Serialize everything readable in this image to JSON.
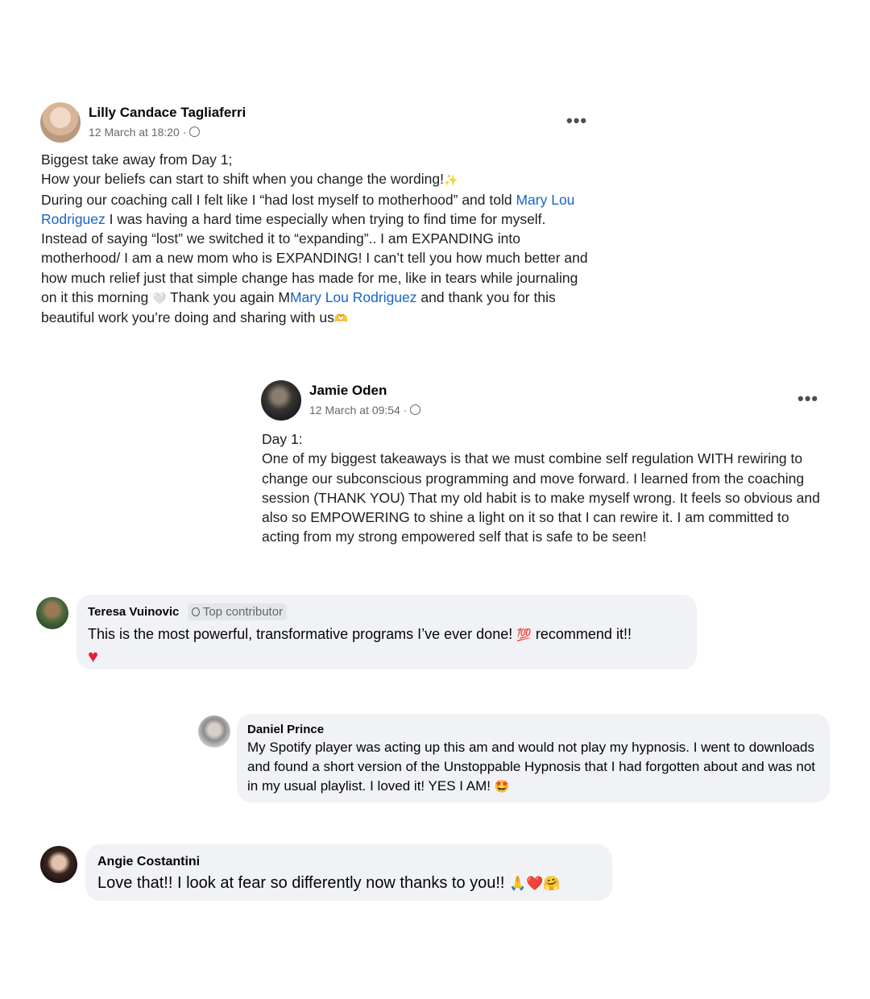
{
  "post1": {
    "author": "Lilly Candace Tagliaferri",
    "timestamp": "12 March at 18:20 ·",
    "privacy_icon": "globe-icon",
    "more_label": "•••",
    "line1": "Biggest take away from Day 1;",
    "line2": "How your beliefs can start to shift when you change the wording!",
    "sparkle": "✨",
    "seg_a": "During our coaching call I felt like I “had lost myself to motherhood” and told ",
    "mention1": "Mary Lou Rodriguez",
    "seg_b": " I was having a hard time especially when trying to find time for myself. Instead of saying “lost” we switched it to “expanding”.. I am EXPANDING into motherhood/ I am a new mom who is EXPANDING! I can’t tell you how much better and how much relief just that simple change has made for me, like in tears while journaling on it this morning ",
    "heart_emoji": "🤍",
    "seg_c": " Thank you again M",
    "mention2": "Mary Lou Rodriguez",
    "seg_d": " and thank you for this beautiful work you’re doing and sharing with us",
    "hands_emoji": "🫶"
  },
  "post2": {
    "author": "Jamie Oden",
    "timestamp": "12 March at 09:54 ·",
    "privacy_icon": "globe-icon",
    "more_label": "•••",
    "line1": "Day 1:",
    "body": "One of my biggest takeaways is that we must combine self regulation WITH rewiring to change our subconscious programming and move forward.  I learned from the coaching session (THANK YOU) That my old habit is to make myself wrong. It feels so obvious and also so EMPOWERING to shine a light on it so that I can rewire it. I am committed to acting from my strong empowered self that is safe to be seen!"
  },
  "comment1": {
    "author": "Teresa Vuinovic",
    "badge": "Top contributor",
    "text_a": "This is the most powerful, transformative programs I’ve ever done! ",
    "emoji_100": "💯",
    "text_b": " recommend it!!",
    "heart": "♥"
  },
  "comment2": {
    "author": "Daniel Prince",
    "text": "My Spotify player was acting up this am and would not play my hypnosis. I went to downloads and found a short version of the Unstoppable Hypnosis that I had forgotten about and was not in my usual playlist. I loved it! YES I AM! ",
    "emoji": "🤩"
  },
  "comment3": {
    "author": "Angie Costantini",
    "text": "Love that!! I look at fear so differently now thanks to you!! ",
    "emojis": "🙏❤️🤗"
  },
  "colors": {
    "link": "#1a63c6",
    "bubble": "#f0f2f5",
    "meta": "#65676b"
  }
}
